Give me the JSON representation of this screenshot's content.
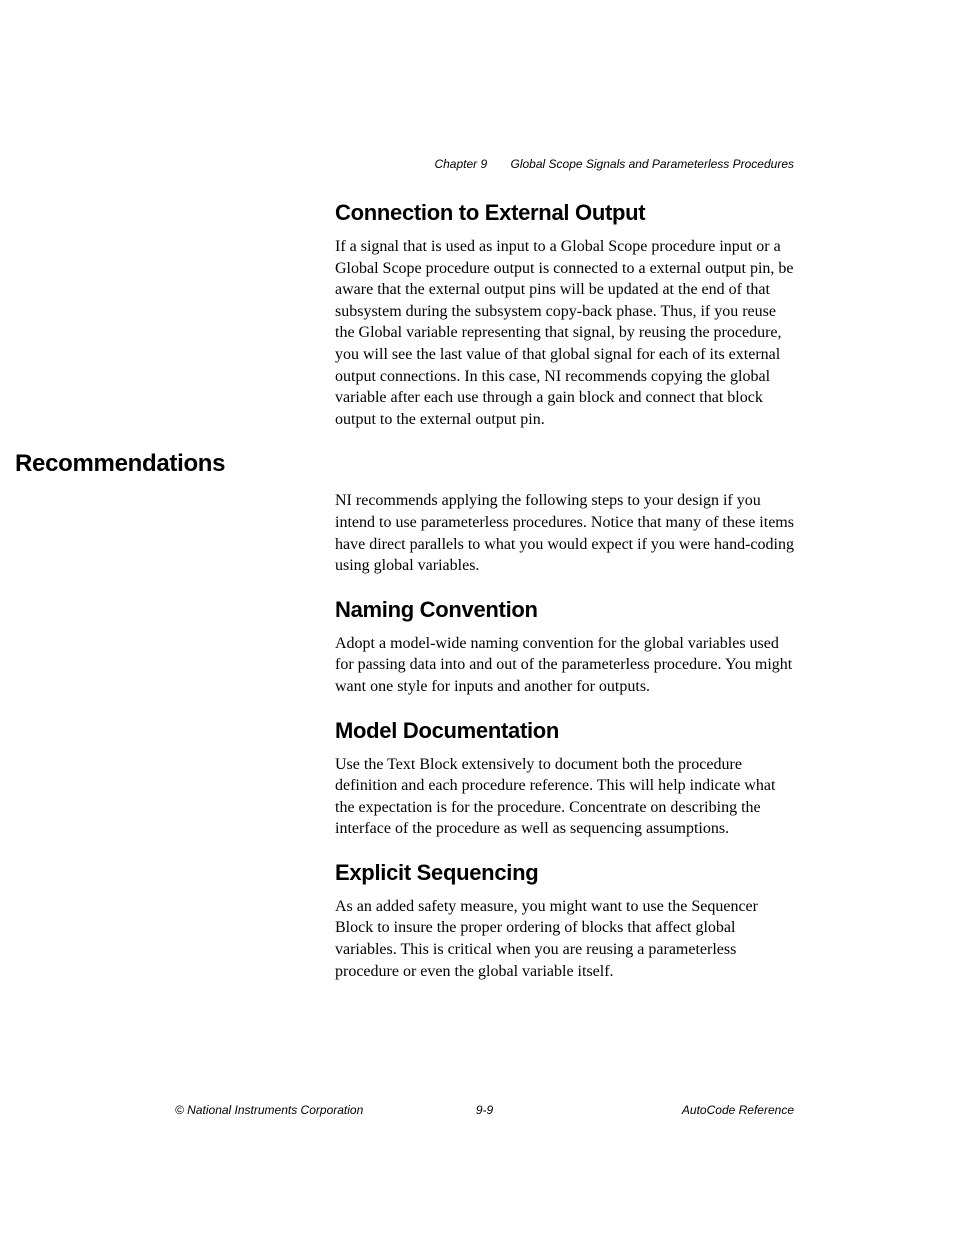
{
  "header": {
    "chapter": "Chapter 9",
    "title": "Global Scope Signals and Parameterless Procedures"
  },
  "sections": [
    {
      "heading": "Connection to External Output",
      "level": "h2",
      "body": "If a signal that is used as input to a Global Scope procedure input or a Global Scope procedure output is connected to a external output pin, be aware that the external output pins will be updated at the end of that subsystem during the subsystem copy-back phase. Thus, if you reuse the Global variable representing that signal, by reusing the procedure, you will see the last value of that global signal for each of its external output connections. In this case, NI recommends copying the global variable after each use through a gain block and connect that block output to the external output pin."
    },
    {
      "heading": "Recommendations",
      "level": "h1",
      "body": "NI recommends applying the following steps to your design if you intend to use parameterless procedures. Notice that many of these items have direct parallels to what you would expect if you were hand-coding using global variables."
    },
    {
      "heading": "Naming Convention",
      "level": "h2",
      "body": "Adopt a model-wide naming convention for the global variables used for passing data into and out of the parameterless procedure. You might want one style for inputs and another for outputs."
    },
    {
      "heading": "Model Documentation",
      "level": "h2",
      "body": "Use the Text Block extensively to document both the procedure definition and each procedure reference. This will help indicate what the expectation is for the procedure. Concentrate on describing the interface of the procedure as well as sequencing assumptions."
    },
    {
      "heading": "Explicit Sequencing",
      "level": "h2",
      "body": "As an added safety measure, you might want to use the Sequencer Block to insure the proper ordering of blocks that affect global variables. This is critical when you are reusing a parameterless procedure or even the global variable itself."
    }
  ],
  "footer": {
    "left": "© National Instruments Corporation",
    "center": "9-9",
    "right": "AutoCode Reference"
  }
}
